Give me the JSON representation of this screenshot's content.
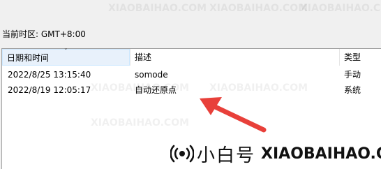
{
  "timezone_label": "当前时区: GMT+8:00",
  "columns": [
    "日期和时间",
    "描述",
    "类型"
  ],
  "rows": [
    {
      "datetime": "2022/8/25 13:15:40",
      "description": "somode",
      "type": "手动"
    },
    {
      "datetime": "2022/8/19 12:05:17",
      "description": "自动还原点",
      "type": "系统"
    }
  ],
  "watermark": {
    "brand_cn": "小白号",
    "brand_en": "XIAOBAIHAO.COM",
    "tile_text": "XIAOBAIHAO.COM"
  },
  "colors": {
    "annotation_arrow": "#e8403a",
    "header_selected": "#e8f1fb"
  }
}
